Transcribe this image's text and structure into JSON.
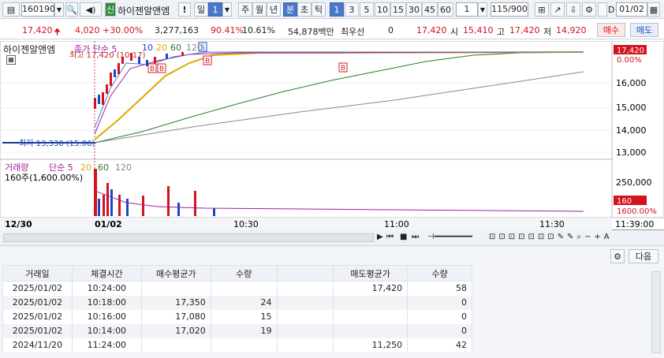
{
  "toolbar": {
    "code": "160190",
    "market_tag": "신",
    "stock_name": "하이젠알앤엠",
    "warn": "!",
    "period_day": "일",
    "period_num": "1",
    "p_week": "주",
    "p_month": "월",
    "p_year": "년",
    "p_min": "분",
    "p_sec": "초",
    "p_tick": "틱",
    "nums": [
      "1",
      "3",
      "5",
      "10",
      "15",
      "30",
      "45",
      "60"
    ],
    "num_sel": "1",
    "count": "115/900",
    "check_d": "D",
    "date": "01/02"
  },
  "price": {
    "price": "17,420",
    "change": "4,020",
    "pct": "+30.00%",
    "volume": "3,277,163",
    "ratio": "90.41%",
    "turn": "10.61%",
    "amount": "54,878백만",
    "quote_label": "최우선",
    "quote_val": "0",
    "quote_price": "17,420",
    "open_label": "시",
    "open": "15,410",
    "high_label": "고",
    "high": "17,420",
    "low_label": "저",
    "low": "14,920",
    "buy": "매수",
    "sell": "매도"
  },
  "chart": {
    "legend": "하이젠알앤엠",
    "ma_label": "종가 단순 5",
    "ma_periods": [
      "10",
      "20",
      "60",
      "120"
    ],
    "hi_note": "최고 17,420 (10:17)",
    "lo_note": "최저 13,330 (15:06)",
    "b_marks": [
      "B",
      "B",
      "B",
      "B"
    ],
    "s_mark": "S",
    "y_top": "17,420",
    "y_pct": "0.00%",
    "y_ticks": [
      "16,000",
      "15,000",
      "14,000",
      "13,000"
    ],
    "x_labels": [
      "12/30",
      "01/02",
      "10:30",
      "11:00",
      "11:30",
      "11:39:00"
    ],
    "vol_label": "거래량",
    "vol_ma": "단순 5",
    "vol_periods": [
      "20",
      "60",
      "120"
    ],
    "vol_sub": "160주(1,600.00%)",
    "vol_tick": "250,000",
    "vol_cur": "160",
    "vol_pct": "1600.00%"
  },
  "lower": {
    "next": "다음",
    "headers": [
      "거래일",
      "체결시간",
      "매수평균가",
      "수량",
      "",
      "매도평균가",
      "수량"
    ],
    "rows": [
      [
        "2025/01/02",
        "10:24:00",
        "",
        "",
        "",
        "17,420",
        "58"
      ],
      [
        "2025/01/02",
        "10:18:00",
        "17,350",
        "24",
        "",
        "",
        "0"
      ],
      [
        "2025/01/02",
        "10:16:00",
        "17,080",
        "15",
        "",
        "",
        "0"
      ],
      [
        "2025/01/02",
        "10:14:00",
        "17,020",
        "19",
        "",
        "",
        "0"
      ],
      [
        "2024/11/20",
        "11:24:00",
        "",
        "",
        "",
        "11,250",
        "42"
      ]
    ]
  },
  "colors": {
    "up": "#d2141e",
    "down": "#1848c8",
    "accent": "#4a77c9"
  }
}
